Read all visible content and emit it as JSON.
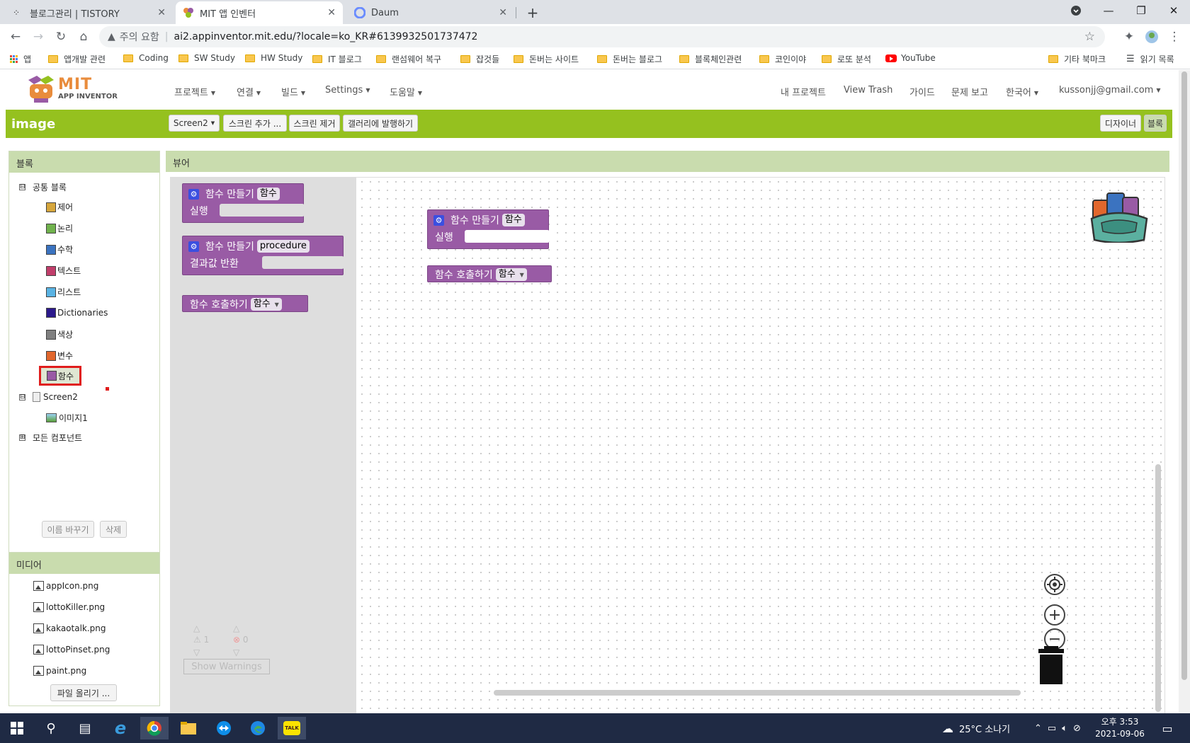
{
  "browser": {
    "tabs": [
      {
        "title": "블로그관리 | TISTORY",
        "active": false
      },
      {
        "title": "MIT 앱 인벤터",
        "active": true
      },
      {
        "title": "Daum",
        "active": false
      }
    ],
    "new_tab": "+",
    "address": {
      "security_label": "주의 요함",
      "url": "ai2.appinventor.mit.edu/?locale=ko_KR#6139932501737472"
    },
    "bookmarks": [
      {
        "label": "앱",
        "icon": "apps-icon"
      },
      {
        "label": "앱개발 관련",
        "icon": "folder-icon"
      },
      {
        "label": "Coding",
        "icon": "folder-icon"
      },
      {
        "label": "SW Study",
        "icon": "folder-icon"
      },
      {
        "label": "HW Study",
        "icon": "folder-icon"
      },
      {
        "label": "IT 블로그",
        "icon": "folder-icon"
      },
      {
        "label": "랜섬웨어 복구",
        "icon": "folder-icon"
      },
      {
        "label": "잡것들",
        "icon": "folder-icon"
      },
      {
        "label": "돈버는 사이트",
        "icon": "folder-icon"
      },
      {
        "label": "돈버는 블로그",
        "icon": "folder-icon"
      },
      {
        "label": "블록체인관련",
        "icon": "folder-icon"
      },
      {
        "label": "코인이야",
        "icon": "folder-icon"
      },
      {
        "label": "로또 분석",
        "icon": "folder-icon"
      },
      {
        "label": "YouTube",
        "icon": "youtube-icon"
      },
      {
        "label": "기타 북마크",
        "icon": "folder-icon"
      },
      {
        "label": "읽기 목록",
        "icon": "reading-list-icon"
      }
    ]
  },
  "app": {
    "logo": {
      "line1": "MIT",
      "line2": "APP INVENTOR"
    },
    "menus": [
      "프로젝트",
      "연결",
      "빌드",
      "Settings",
      "도움말"
    ],
    "right_links": [
      "내 프로젝트",
      "View Trash",
      "가이드",
      "문제 보고",
      "한국어",
      "kussonjj@gmail.com"
    ],
    "project_name": "image",
    "screen_buttons": [
      "Screen2",
      "스크린 추가 ...",
      "스크린 제거",
      "갤러리에 발행하기"
    ],
    "mode_buttons": [
      "디자이너",
      "블록"
    ],
    "blocks_panel": {
      "title": "블록",
      "builtin_label": "공통 블록",
      "builtin_toggle": "⊟",
      "builtin": [
        {
          "label": "제어",
          "color": "#d6a63c"
        },
        {
          "label": "논리",
          "color": "#70b24d"
        },
        {
          "label": "수학",
          "color": "#3b73c0"
        },
        {
          "label": "텍스트",
          "color": "#c13e6b"
        },
        {
          "label": "리스트",
          "color": "#5ab3e3"
        },
        {
          "label": "Dictionaries",
          "color": "#2c1a8c"
        },
        {
          "label": "색상",
          "color": "#808080"
        },
        {
          "label": "변수",
          "color": "#e1672d"
        },
        {
          "label": "함수",
          "color": "#995ba5"
        }
      ],
      "screen_label": "Screen2",
      "screen_toggle": "⊟",
      "screen_children": [
        "이미지1"
      ],
      "all_components_label": "모든 컴포넌트",
      "all_toggle": "⊞",
      "rename_button": "이름 바꾸기",
      "delete_button": "삭제"
    },
    "media_panel": {
      "title": "미디어",
      "files": [
        "appIcon.png",
        "lottoKiller.png",
        "kakaotalk.png",
        "lottoPinset.png",
        "paint.png"
      ],
      "upload_button": "파일 올리기 ..."
    },
    "viewer": {
      "title": "뷰어",
      "flyout_blocks": {
        "define_proc": {
          "keyword": "함수 만들기",
          "name": "함수",
          "body": "실행"
        },
        "define_proc_return": {
          "keyword": "함수 만들기",
          "name": "procedure",
          "body": "결과값 반환"
        },
        "call_proc": {
          "keyword": "함수 호출하기",
          "name": "함수"
        }
      },
      "workspace_blocks": {
        "define_proc": {
          "keyword": "함수 만들기",
          "name": "함수",
          "body": "실행"
        },
        "call_proc": {
          "keyword": "함수 호출하기",
          "name": "함수"
        }
      },
      "warnings": {
        "warning_count": "1",
        "error_count": "0",
        "button": "Show Warnings"
      }
    }
  },
  "taskbar": {
    "weather": "25°C 소나기",
    "time": "오후 3:53",
    "date": "2021-09-06"
  }
}
